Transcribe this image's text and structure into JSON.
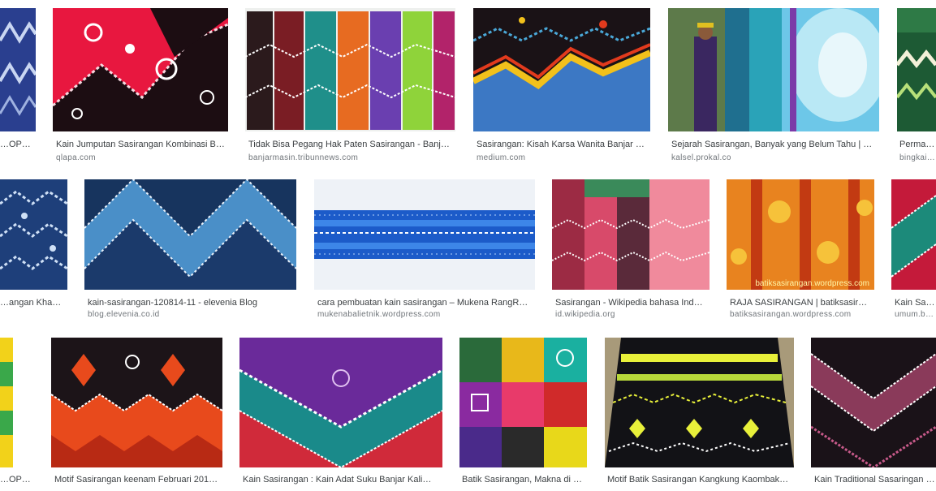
{
  "results": [
    {
      "caption": "…OP | …",
      "source": ""
    },
    {
      "caption": "Kain Jumputan Sasirangan Kombinasi B…",
      "source": "qlapa.com"
    },
    {
      "caption": "Tidak Bisa Pegang Hak Paten Sasirangan - Banj…",
      "source": "banjarmasin.tribunnews.com"
    },
    {
      "caption": "Sasirangan: Kisah Karsa Wanita Banjar …",
      "source": "medium.com"
    },
    {
      "caption": "Sejarah Sasirangan, Banyak yang Belum Tahu | …",
      "source": "kalsel.prokal.co"
    },
    {
      "caption": "Permata …",
      "source": "bingkaiba…"
    },
    {
      "caption": "…angan Khas …",
      "source": ""
    },
    {
      "caption": "kain-sasirangan-120814-11 - elevenia Blog",
      "source": "blog.elevenia.co.id"
    },
    {
      "caption": "cara pembuatan kain sasirangan – Mukena RangR…",
      "source": "mukenabalietnik.wordpress.com"
    },
    {
      "caption": "Sasirangan - Wikipedia bahasa Ind…",
      "source": "id.wikipedia.org"
    },
    {
      "caption": "RAJA SASIRANGAN | batiksasir…",
      "source": "batiksasirangan.wordpress.com",
      "watermark": "batiksasirangan.wordpress.com"
    },
    {
      "caption": "Kain Sasir…",
      "source": "umum.ban…"
    },
    {
      "caption": "…OP | L…",
      "source": ""
    },
    {
      "caption": "Motif Sasirangan keenam Februari 201…",
      "source": ""
    },
    {
      "caption": "Kain Sasirangan : Kain Adat Suku Banjar Kali…",
      "source": ""
    },
    {
      "caption": "Batik Sasirangan, Makna di …",
      "source": ""
    },
    {
      "caption": "Motif Batik Sasirangan Kangkung Kaombak…",
      "source": ""
    },
    {
      "caption": "Kain Traditional Sasaringan | C…",
      "source": ""
    }
  ],
  "palette": {
    "caption_text": "#3c4043",
    "source_text": "#70757a"
  }
}
